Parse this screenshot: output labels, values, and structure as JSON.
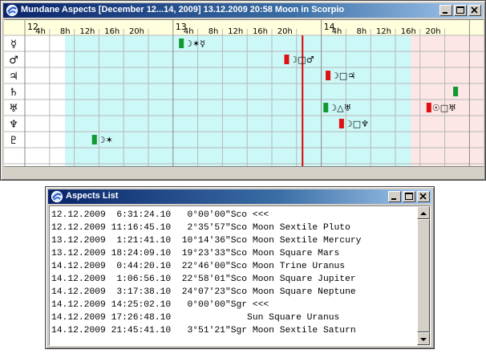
{
  "main_window": {
    "title": "Mundane Aspects [December 12...14, 2009]  13.12.2009 20:58  Moon in Scorpio",
    "icon": "globe-icon",
    "buttons": [
      "minimize-icon",
      "maximize-icon",
      "close-icon"
    ]
  },
  "timeline": {
    "day_labels": [
      "12",
      "13",
      "14"
    ],
    "hour_labels": [
      "4h",
      "8h",
      "12h",
      "16h",
      "20h",
      "4h",
      "8h",
      "12h",
      "16h",
      "20h",
      "4h",
      "8h",
      "12h",
      "16h",
      "20h"
    ],
    "row_glyphs": [
      "☿",
      "♂",
      "♃",
      "♄",
      "♅",
      "♆",
      "♇"
    ],
    "row_names": [
      "Mercury",
      "Mars",
      "Jupiter",
      "Saturn",
      "Uranus",
      "Neptune",
      "Pluto"
    ],
    "current_time": "13.12.2009 20:58",
    "colors": {
      "header_bg": "#ffffdd",
      "day_zone": "#ccf8f8",
      "evening_zone": "#fde6e6",
      "grid": "#b8b8b8",
      "now_line": "#e00000",
      "harmonious": "#119933",
      "tense": "#dd1111"
    },
    "events": [
      {
        "row": 0,
        "label": "☽✶☿",
        "time": "13.12.2009 1:21",
        "kind": "harmonious"
      },
      {
        "row": 1,
        "label": "☽□♂",
        "time": "13.12.2009 18:24",
        "kind": "tense"
      },
      {
        "row": 2,
        "label": "☽□♃",
        "time": "14.12.2009 1:06",
        "kind": "tense"
      },
      {
        "row": 3,
        "label": "",
        "time": "14.12.2009 21:45",
        "kind": "harmonious"
      },
      {
        "row": 4,
        "label": "☽△♅",
        "time": "14.12.2009 0:44",
        "kind": "harmonious"
      },
      {
        "row": 4,
        "label": "☉□♅",
        "time": "14.12.2009 17:26",
        "kind": "tense"
      },
      {
        "row": 5,
        "label": "☽□♆",
        "time": "14.12.2009 3:17",
        "kind": "tense"
      },
      {
        "row": 6,
        "label": "☽✶",
        "time": "12.12.2009 11:16",
        "kind": "harmonious"
      }
    ]
  },
  "aspects_list": {
    "title": "Aspects List",
    "icon": "globe-icon",
    "buttons": [
      "minimize-icon",
      "maximize-icon",
      "close-icon"
    ],
    "lines": [
      "12.12.2009  6:31:24.10   0°00'00\"Sco <<<",
      "12.12.2009 11:16:45.10   2°35'57\"Sco Moon Sextile Pluto",
      "13.12.2009  1:21:41.10  10°14'36\"Sco Moon Sextile Mercury",
      "13.12.2009 18:24:09.10  19°23'33\"Sco Moon Square Mars",
      "14.12.2009  0:44:20.10  22°46'00\"Sco Moon Trine Uranus",
      "14.12.2009  1:06:56.10  22°58'01\"Sco Moon Square Jupiter",
      "14.12.2009  3:17:38.10  24°07'23\"Sco Moon Square Neptune",
      "14.12.2009 14:25:02.10   0°00'00\"Sgr <<<",
      "14.12.2009 17:26:48.10              Sun Square Uranus",
      "14.12.2009 21:45:41.10   3°51'21\"Sgr Moon Sextile Saturn"
    ]
  }
}
